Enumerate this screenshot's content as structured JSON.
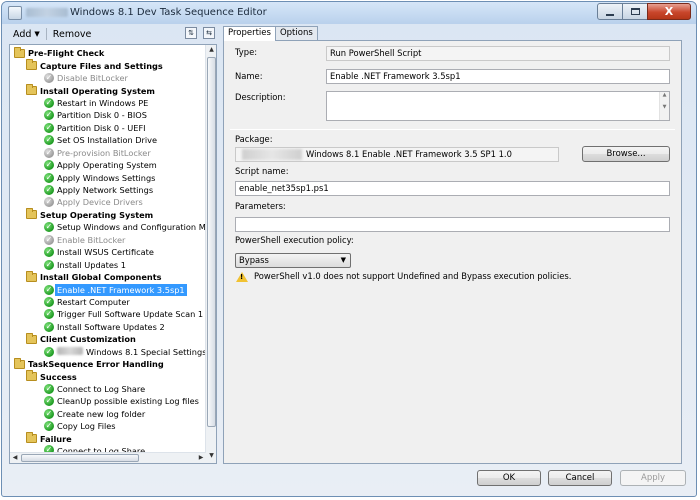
{
  "window": {
    "title": "Windows 8.1 Dev Task Sequence Editor",
    "buttons": {
      "minimize": "",
      "maximize": "",
      "close": "X"
    }
  },
  "toolbar": {
    "add_label": "Add",
    "remove_label": "Remove"
  },
  "tree": {
    "items": [
      {
        "label": "Pre-Flight Check",
        "level": 0,
        "type": "group"
      },
      {
        "label": "Capture Files and Settings",
        "level": 1,
        "type": "group"
      },
      {
        "label": "Disable BitLocker",
        "level": 2,
        "type": "step",
        "disabled": true
      },
      {
        "label": "Install Operating System",
        "level": 1,
        "type": "group"
      },
      {
        "label": "Restart in Windows PE",
        "level": 2,
        "type": "step"
      },
      {
        "label": "Partition Disk 0 - BIOS",
        "level": 2,
        "type": "step"
      },
      {
        "label": "Partition Disk 0 - UEFI",
        "level": 2,
        "type": "step"
      },
      {
        "label": "Set OS Installation Drive",
        "level": 2,
        "type": "step"
      },
      {
        "label": "Pre-provision BitLocker",
        "level": 2,
        "type": "step",
        "disabled": true
      },
      {
        "label": "Apply Operating System",
        "level": 2,
        "type": "step"
      },
      {
        "label": "Apply Windows Settings",
        "level": 2,
        "type": "step"
      },
      {
        "label": "Apply Network Settings",
        "level": 2,
        "type": "step"
      },
      {
        "label": "Apply Device Drivers",
        "level": 2,
        "type": "step",
        "disabled": true
      },
      {
        "label": "Setup Operating System",
        "level": 1,
        "type": "group"
      },
      {
        "label": "Setup Windows and Configuration Mar",
        "level": 2,
        "type": "step"
      },
      {
        "label": "Enable BitLocker",
        "level": 2,
        "type": "step",
        "disabled": true
      },
      {
        "label": "Install WSUS Certificate",
        "level": 2,
        "type": "step"
      },
      {
        "label": "Install Updates 1",
        "level": 2,
        "type": "step"
      },
      {
        "label": "Install Global Components",
        "level": 1,
        "type": "group"
      },
      {
        "label": "Enable .NET Framework 3.5sp1",
        "level": 2,
        "type": "step",
        "selected": true
      },
      {
        "label": "Restart Computer",
        "level": 2,
        "type": "step"
      },
      {
        "label": "Trigger Full Software Update Scan 1",
        "level": 2,
        "type": "step"
      },
      {
        "label": "Install Software Updates 2",
        "level": 2,
        "type": "step"
      },
      {
        "label": "Client Customization",
        "level": 1,
        "type": "group"
      },
      {
        "label": "Windows 8.1 Special Settings",
        "level": 2,
        "type": "step",
        "redacted_prefix": true
      },
      {
        "label": "TaskSequence Error Handling",
        "level": 0,
        "type": "group"
      },
      {
        "label": "Success",
        "level": 1,
        "type": "group"
      },
      {
        "label": "Connect to Log Share",
        "level": 2,
        "type": "step"
      },
      {
        "label": "CleanUp possible existing Log files",
        "level": 2,
        "type": "step"
      },
      {
        "label": "Create new log folder",
        "level": 2,
        "type": "step"
      },
      {
        "label": "Copy Log Files",
        "level": 2,
        "type": "step"
      },
      {
        "label": "Failure",
        "level": 1,
        "type": "group"
      },
      {
        "label": "Connect to Log Share",
        "level": 2,
        "type": "step",
        "clipped": true
      }
    ]
  },
  "tabs": [
    {
      "label": "Properties",
      "active": true
    },
    {
      "label": "Options",
      "active": false
    }
  ],
  "properties": {
    "type_label": "Type:",
    "type_value": "Run PowerShell Script",
    "name_label": "Name:",
    "name_value": "Enable .NET Framework 3.5sp1",
    "description_label": "Description:",
    "description_value": "",
    "package_label": "Package:",
    "package_value": "Windows 8.1 Enable .NET Framework 3.5 SP1 1.0",
    "browse_label": "Browse...",
    "script_name_label": "Script name:",
    "script_name_value": "enable_net35sp1.ps1",
    "parameters_label": "Parameters:",
    "parameters_value": "",
    "policy_label": "PowerShell execution policy:",
    "policy_value": "Bypass",
    "warning_text": "PowerShell v1.0 does not support Undefined and Bypass execution policies."
  },
  "dialog_buttons": {
    "ok": "OK",
    "cancel": "Cancel",
    "apply": "Apply"
  }
}
